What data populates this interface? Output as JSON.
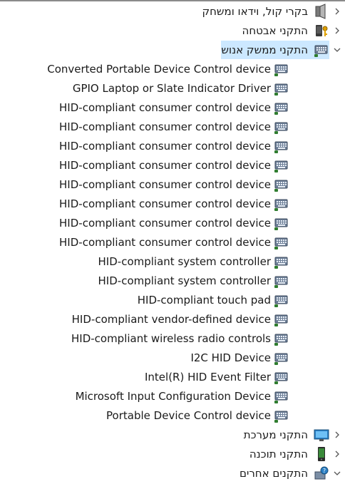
{
  "categories": [
    {
      "label": "בקרי קול, וידאו ומשחק",
      "icon": "speaker-icon",
      "expanded": false
    },
    {
      "label": "התקני אבטחה",
      "icon": "security-key-icon",
      "expanded": false
    },
    {
      "label": "התקני ממשק אנוש",
      "icon": "keyboard-icon",
      "expanded": true
    }
  ],
  "devices": [
    {
      "label": "Converted Portable Device Control device",
      "icon": "keyboard-icon"
    },
    {
      "label": "GPIO Laptop or Slate Indicator Driver",
      "icon": "keyboard-icon"
    },
    {
      "label": "HID-compliant consumer control device",
      "icon": "keyboard-icon"
    },
    {
      "label": "HID-compliant consumer control device",
      "icon": "keyboard-icon"
    },
    {
      "label": "HID-compliant consumer control device",
      "icon": "keyboard-icon"
    },
    {
      "label": "HID-compliant consumer control device",
      "icon": "keyboard-icon"
    },
    {
      "label": "HID-compliant consumer control device",
      "icon": "keyboard-icon"
    },
    {
      "label": "HID-compliant consumer control device",
      "icon": "keyboard-icon"
    },
    {
      "label": "HID-compliant consumer control device",
      "icon": "keyboard-icon"
    },
    {
      "label": "HID-compliant consumer control device",
      "icon": "keyboard-icon"
    },
    {
      "label": "HID-compliant system controller",
      "icon": "keyboard-icon"
    },
    {
      "label": "HID-compliant system controller",
      "icon": "keyboard-icon"
    },
    {
      "label": "HID-compliant touch pad",
      "icon": "keyboard-icon"
    },
    {
      "label": "HID-compliant vendor-defined device",
      "icon": "keyboard-icon"
    },
    {
      "label": "HID-compliant wireless radio controls",
      "icon": "keyboard-icon"
    },
    {
      "label": "I2C HID Device",
      "icon": "keyboard-icon"
    },
    {
      "label": "Intel(R) HID Event Filter",
      "icon": "keyboard-icon"
    },
    {
      "label": "Microsoft Input Configuration Device",
      "icon": "keyboard-icon"
    },
    {
      "label": "Portable Device Control device",
      "icon": "keyboard-icon"
    }
  ],
  "categories_after": [
    {
      "label": "התקני מערכת",
      "icon": "monitor-icon",
      "expanded": false
    },
    {
      "label": "התקני תוכנה",
      "icon": "phone-icon",
      "expanded": false
    },
    {
      "label": "התקנים אחרים",
      "icon": "unknown-device-icon",
      "expanded": true
    }
  ],
  "colors": {
    "selection": "#cce8ff",
    "text": "#1a1a1a"
  }
}
